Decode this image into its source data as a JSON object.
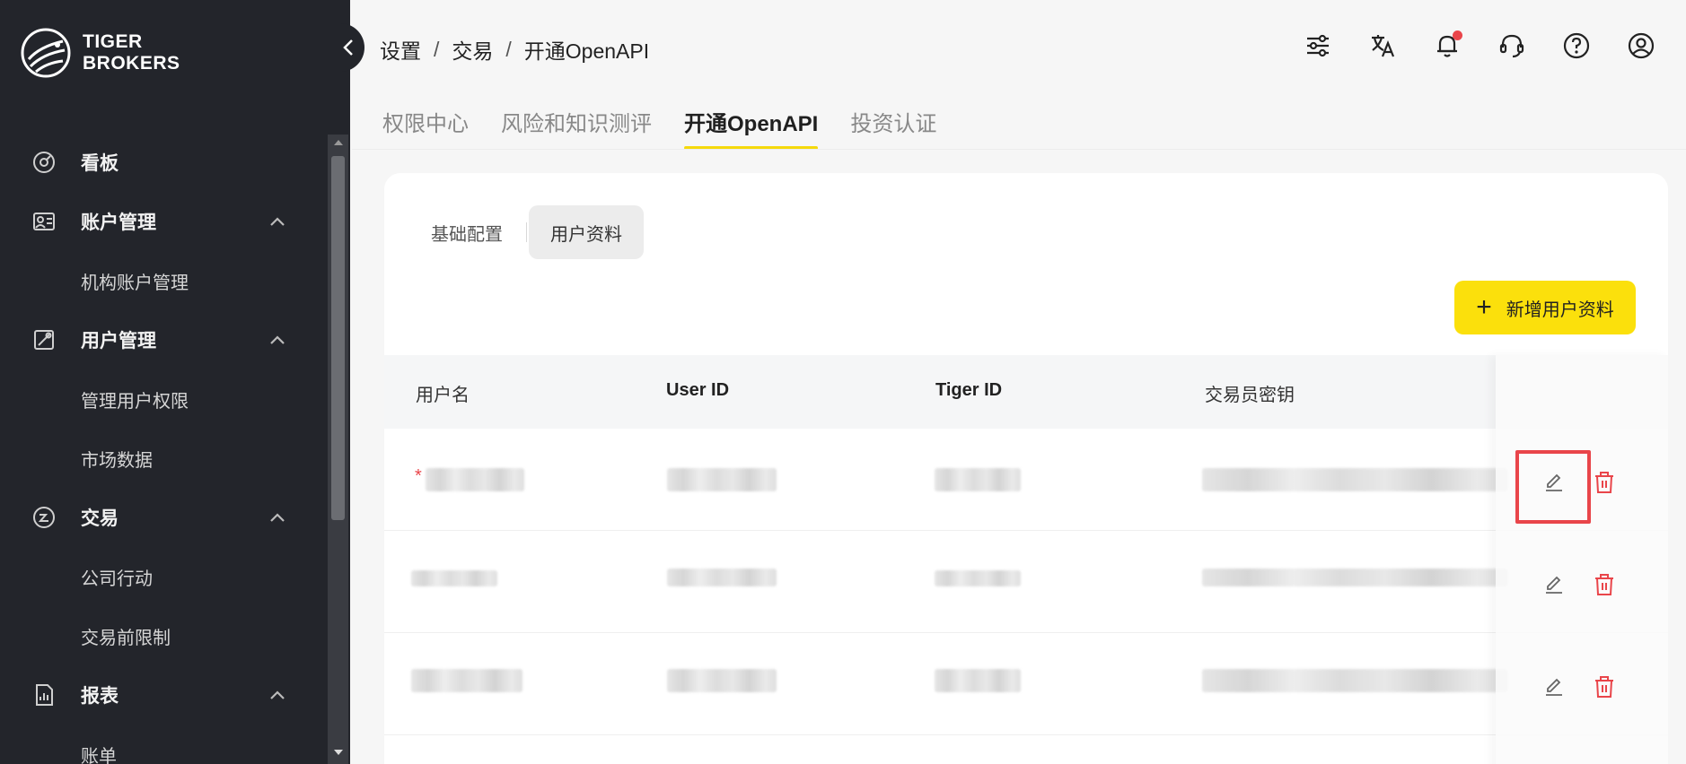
{
  "brand": {
    "line1": "TIGER",
    "line2": "BROKERS"
  },
  "sidebar": {
    "items": [
      {
        "label": "看板",
        "icon": "dashboard-icon"
      },
      {
        "label": "账户管理",
        "icon": "account-card-icon",
        "expanded": true,
        "children": [
          "机构账户管理"
        ]
      },
      {
        "label": "用户管理",
        "icon": "user-settings-icon",
        "expanded": true,
        "children": [
          "管理用户权限",
          "市场数据"
        ]
      },
      {
        "label": "交易",
        "icon": "trade-icon",
        "expanded": true,
        "children": [
          "公司行动",
          "交易前限制"
        ]
      },
      {
        "label": "报表",
        "icon": "report-icon",
        "expanded": true,
        "children": [
          "账单"
        ]
      }
    ]
  },
  "breadcrumb": [
    "设置",
    "交易",
    "开通OpenAPI"
  ],
  "breadcrumb_sep": "/",
  "header_icons": [
    "sliders-icon",
    "translate-icon",
    "bell-icon",
    "headset-icon",
    "help-icon",
    "user-icon"
  ],
  "tabs": [
    {
      "label": "权限中心",
      "active": false
    },
    {
      "label": "风险和知识测评",
      "active": false
    },
    {
      "label": "开通OpenAPI",
      "active": true
    },
    {
      "label": "投资认证",
      "active": false
    }
  ],
  "segments": [
    {
      "label": "基础配置",
      "active": false
    },
    {
      "label": "用户资料",
      "active": true
    }
  ],
  "add_button": {
    "plus": "+",
    "label": "新增用户资料"
  },
  "table": {
    "columns": [
      "用户名",
      "User ID",
      "Tiger ID",
      "交易员密钥"
    ],
    "required_mark": "*"
  },
  "colors": {
    "accent": "#fbe00c",
    "sidebar": "#23252b",
    "danger": "#e9454a"
  }
}
